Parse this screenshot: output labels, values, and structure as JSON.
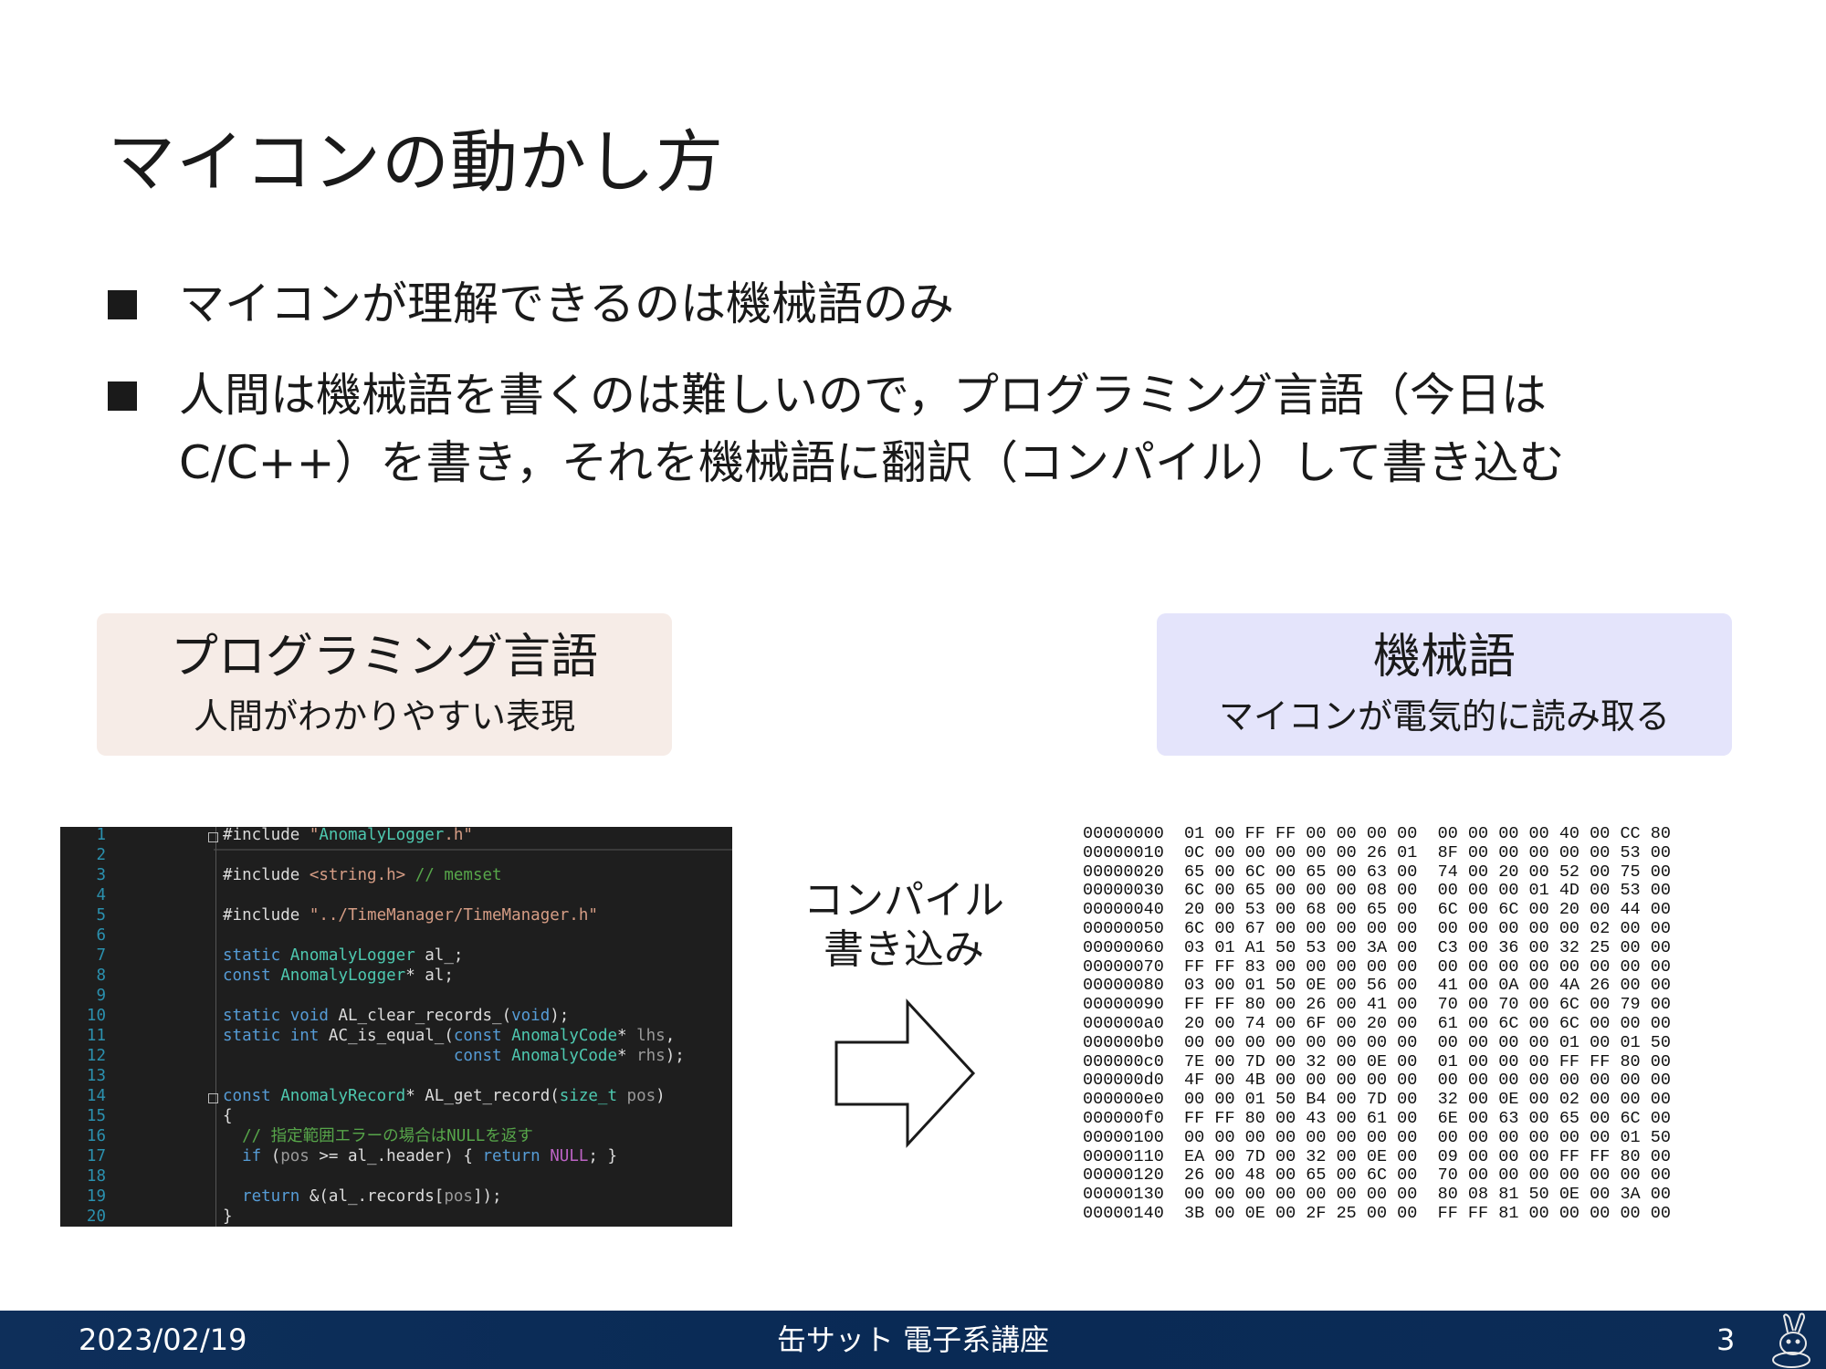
{
  "slide": {
    "title": "マイコンの動かし方",
    "bullets": [
      {
        "lines": [
          "マイコンが理解できるのは機械語のみ"
        ]
      },
      {
        "lines": [
          "人間は機械語を書くのは難しいので，プログラミング言語（今日は",
          "C/C++）を書き，それを機械語に翻訳（コンパイル）して書き込む"
        ]
      }
    ]
  },
  "cards": {
    "left": {
      "title": "プログラミング言語",
      "subtitle": "人間がわかりやすい表現"
    },
    "right": {
      "title": "機械語",
      "subtitle": "マイコンが電気的に読み取る"
    }
  },
  "arrow": {
    "label_line1": "コンパイル",
    "label_line2": "書き込み"
  },
  "code": {
    "lines": [
      {
        "n": "1",
        "text": "#include \"AnomalyLogger.h\""
      },
      {
        "n": "2",
        "text": ""
      },
      {
        "n": "3",
        "text": "#include <string.h> // memset"
      },
      {
        "n": "4",
        "text": ""
      },
      {
        "n": "5",
        "text": "#include \"../TimeManager/TimeManager.h\""
      },
      {
        "n": "6",
        "text": ""
      },
      {
        "n": "7",
        "text": "static AnomalyLogger al_;"
      },
      {
        "n": "8",
        "text": "const AnomalyLogger* al;"
      },
      {
        "n": "9",
        "text": ""
      },
      {
        "n": "10",
        "text": "static void AL_clear_records_(void);"
      },
      {
        "n": "11",
        "text": "static int AC_is_equal_(const AnomalyCode* lhs,"
      },
      {
        "n": "12",
        "text": "                        const AnomalyCode* rhs);"
      },
      {
        "n": "13",
        "text": ""
      },
      {
        "n": "14",
        "text": "const AnomalyRecord* AL_get_record(size_t pos)"
      },
      {
        "n": "15",
        "text": "{"
      },
      {
        "n": "16",
        "text": "  // 指定範囲エラーの場合はNULLを返す"
      },
      {
        "n": "17",
        "text": "  if (pos >= al_.header) { return NULL; }"
      },
      {
        "n": "18",
        "text": ""
      },
      {
        "n": "19",
        "text": "  return &(al_.records[pos]);"
      },
      {
        "n": "20",
        "text": "}"
      }
    ]
  },
  "hex": {
    "rows": [
      {
        "addr": "00000000",
        "a": "01 00 FF FF 00 00 00 00",
        "b": "00 00 00 00 40 00 CC 80"
      },
      {
        "addr": "00000010",
        "a": "0C 00 00 00 00 00 26 01",
        "b": "8F 00 00 00 00 00 53 00"
      },
      {
        "addr": "00000020",
        "a": "65 00 6C 00 65 00 63 00",
        "b": "74 00 20 00 52 00 75 00"
      },
      {
        "addr": "00000030",
        "a": "6C 00 65 00 00 00 08 00",
        "b": "00 00 00 01 4D 00 53 00"
      },
      {
        "addr": "00000040",
        "a": "20 00 53 00 68 00 65 00",
        "b": "6C 00 6C 00 20 00 44 00"
      },
      {
        "addr": "00000050",
        "a": "6C 00 67 00 00 00 00 00",
        "b": "00 00 00 00 00 02 00 00"
      },
      {
        "addr": "00000060",
        "a": "03 01 A1 50 53 00 3A 00",
        "b": "C3 00 36 00 32 25 00 00"
      },
      {
        "addr": "00000070",
        "a": "FF FF 83 00 00 00 00 00",
        "b": "00 00 00 00 00 00 00 00"
      },
      {
        "addr": "00000080",
        "a": "03 00 01 50 0E 00 56 00",
        "b": "41 00 0A 00 4A 26 00 00"
      },
      {
        "addr": "00000090",
        "a": "FF FF 80 00 26 00 41 00",
        "b": "70 00 70 00 6C 00 79 00"
      },
      {
        "addr": "000000a0",
        "a": "20 00 74 00 6F 00 20 00",
        "b": "61 00 6C 00 6C 00 00 00"
      },
      {
        "addr": "000000b0",
        "a": "00 00 00 00 00 00 00 00",
        "b": "00 00 00 00 01 00 01 50"
      },
      {
        "addr": "000000c0",
        "a": "7E 00 7D 00 32 00 0E 00",
        "b": "01 00 00 00 FF FF 80 00"
      },
      {
        "addr": "000000d0",
        "a": "4F 00 4B 00 00 00 00 00",
        "b": "00 00 00 00 00 00 00 00"
      },
      {
        "addr": "000000e0",
        "a": "00 00 01 50 B4 00 7D 00",
        "b": "32 00 0E 00 02 00 00 00"
      },
      {
        "addr": "000000f0",
        "a": "FF FF 80 00 43 00 61 00",
        "b": "6E 00 63 00 65 00 6C 00"
      },
      {
        "addr": "00000100",
        "a": "00 00 00 00 00 00 00 00",
        "b": "00 00 00 00 00 00 01 50"
      },
      {
        "addr": "00000110",
        "a": "EA 00 7D 00 32 00 0E 00",
        "b": "09 00 00 00 FF FF 80 00"
      },
      {
        "addr": "00000120",
        "a": "26 00 48 00 65 00 6C 00",
        "b": "70 00 00 00 00 00 00 00"
      },
      {
        "addr": "00000130",
        "a": "00 00 00 00 00 00 00 00",
        "b": "80 08 81 50 0E 00 3A 00"
      },
      {
        "addr": "00000140",
        "a": "3B 00 0E 00 2F 25 00 00",
        "b": "FF FF 81 00 00 00 00 00"
      }
    ]
  },
  "footer": {
    "date": "2023/02/19",
    "center": "缶サット 電子系講座",
    "page": "3"
  },
  "colors": {
    "footer_bg": "#0e2f5a",
    "card_left_bg": "#f6ece7",
    "card_right_bg": "#e4e4fb",
    "code_bg": "#1e1e1e"
  },
  "icons": {
    "arrow": "right-arrow-outline",
    "logo": "rabbit-mascot-icon"
  }
}
